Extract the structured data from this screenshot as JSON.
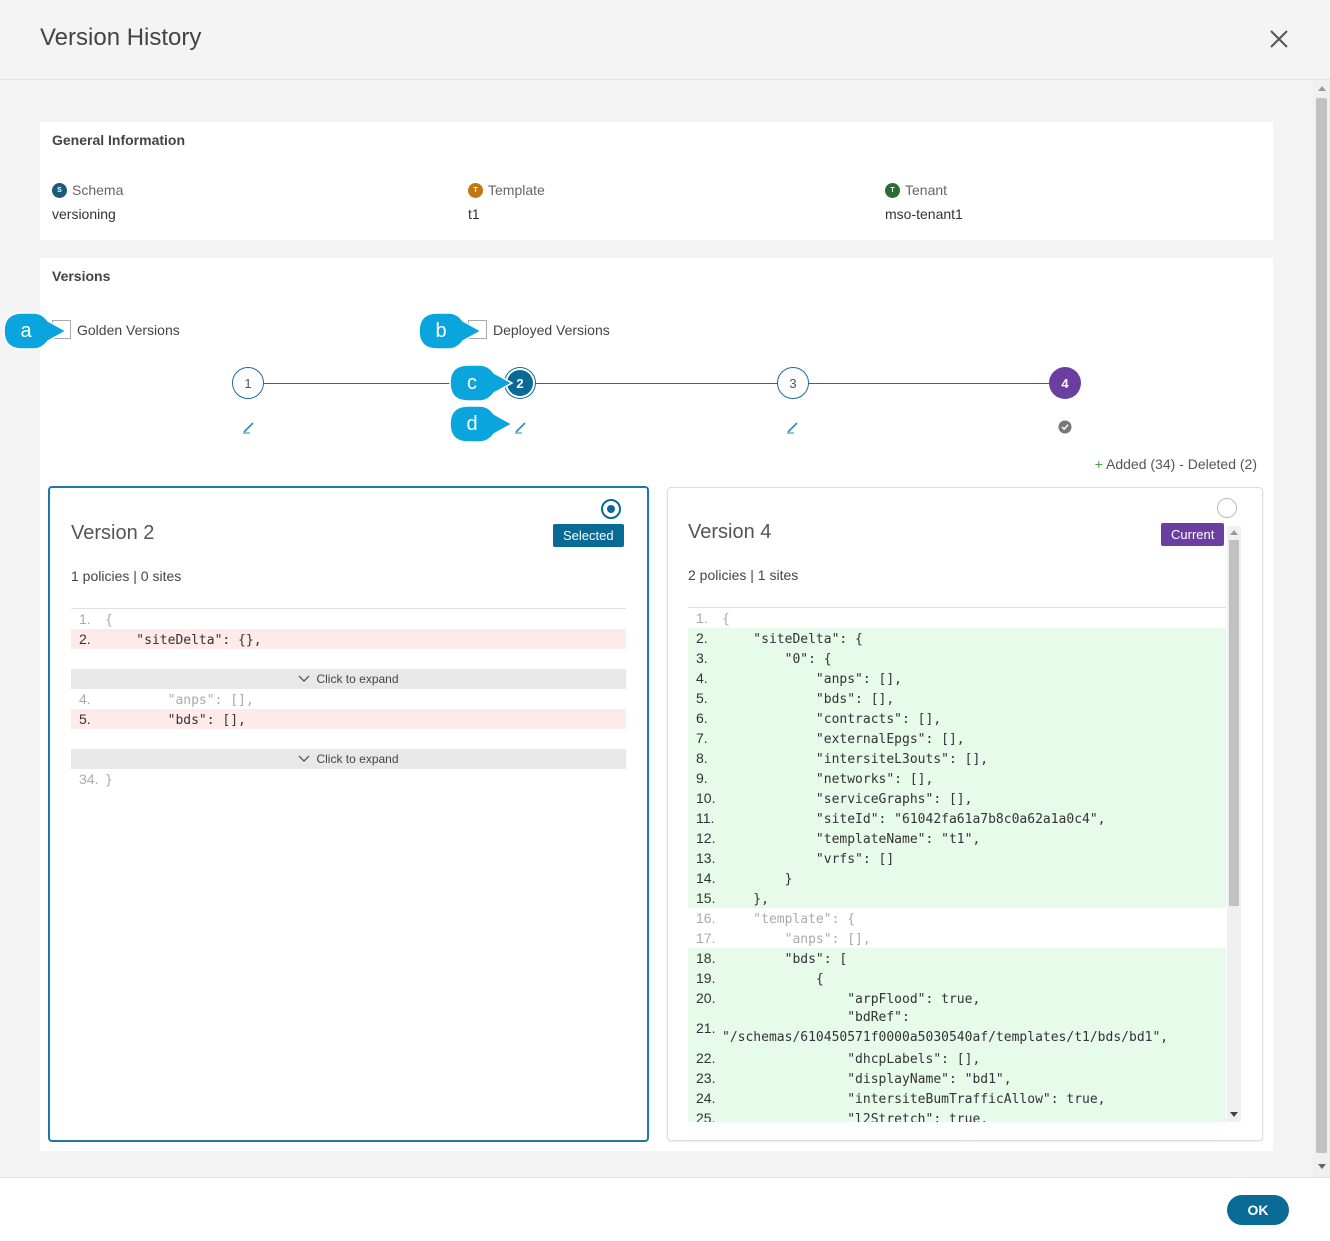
{
  "header": {
    "title": "Version History"
  },
  "general": {
    "title": "General Information",
    "schema": {
      "label": "Schema",
      "value": "versioning",
      "dot": "S",
      "color": "#1b5a7a"
    },
    "template": {
      "label": "Template",
      "value": "t1",
      "dot": "T",
      "color": "#c47612"
    },
    "tenant": {
      "label": "Tenant",
      "value": "mso-tenant1",
      "dot": "T",
      "color": "#2a6d35"
    }
  },
  "versions": {
    "title": "Versions",
    "golden_label": "Golden Versions",
    "deployed_label": "Deployed Versions",
    "nodes": [
      "1",
      "2",
      "3",
      "4"
    ],
    "callouts": [
      "a",
      "b",
      "c",
      "d"
    ],
    "changes_added": "Added (34)",
    "changes_sep": " - ",
    "changes_deleted": "Deleted (2)"
  },
  "left_card": {
    "title": "Version 2",
    "badge": "Selected",
    "meta": "1 policies | 0 sites",
    "expand_label": "Click to expand",
    "lines": [
      {
        "n": "1.",
        "t": "{"
      },
      {
        "n": "2.",
        "t": "    \"siteDelta\": {},"
      },
      {
        "n": "4.",
        "t": "        \"anps\": [],"
      },
      {
        "n": "5.",
        "t": "        \"bds\": [],"
      },
      {
        "n": "34.",
        "t": "}"
      }
    ]
  },
  "right_card": {
    "title": "Version 4",
    "badge": "Current",
    "meta": "2 policies | 1 sites",
    "lines": [
      {
        "n": "1.",
        "t": "{"
      },
      {
        "n": "2.",
        "t": "    \"siteDelta\": {"
      },
      {
        "n": "3.",
        "t": "        \"0\": {"
      },
      {
        "n": "4.",
        "t": "            \"anps\": [],"
      },
      {
        "n": "5.",
        "t": "            \"bds\": [],"
      },
      {
        "n": "6.",
        "t": "            \"contracts\": [],"
      },
      {
        "n": "7.",
        "t": "            \"externalEpgs\": [],"
      },
      {
        "n": "8.",
        "t": "            \"intersiteL3outs\": [],"
      },
      {
        "n": "9.",
        "t": "            \"networks\": [],"
      },
      {
        "n": "10.",
        "t": "            \"serviceGraphs\": [],"
      },
      {
        "n": "11.",
        "t": "            \"siteId\": \"61042fa61a7b8c0a62a1a0c4\","
      },
      {
        "n": "12.",
        "t": "            \"templateName\": \"t1\","
      },
      {
        "n": "13.",
        "t": "            \"vrfs\": []"
      },
      {
        "n": "14.",
        "t": "        }"
      },
      {
        "n": "15.",
        "t": "    },"
      },
      {
        "n": "16.",
        "t": "    \"template\": {"
      },
      {
        "n": "17.",
        "t": "        \"anps\": [],"
      },
      {
        "n": "18.",
        "t": "        \"bds\": ["
      },
      {
        "n": "19.",
        "t": "            {"
      },
      {
        "n": "20.",
        "t": "                \"arpFlood\": true,"
      },
      {
        "n": "21.",
        "t": "                \"bdRef\":",
        "t2": "\"/schemas/610450571f0000a5030540af/templates/t1/bds/bd1\","
      },
      {
        "n": "22.",
        "t": "                \"dhcpLabels\": [],"
      },
      {
        "n": "23.",
        "t": "                \"displayName\": \"bd1\","
      },
      {
        "n": "24.",
        "t": "                \"intersiteBumTrafficAllow\": true,"
      },
      {
        "n": "25.",
        "t": "                \"l2Stretch\": true,"
      }
    ]
  },
  "footer": {
    "ok_label": "OK"
  },
  "colors": {
    "primary": "#0a6a96",
    "current": "#6b3fa0",
    "added_bg": "#e6fbe9",
    "deleted_bg": "#ffeaea"
  }
}
